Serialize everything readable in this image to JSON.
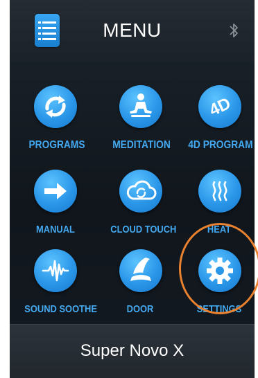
{
  "header": {
    "title": "MENU",
    "menu_icon": "list-menu-icon",
    "bluetooth_icon": "bluetooth-icon"
  },
  "tiles": [
    {
      "label": "PROGRAMS",
      "icon": "refresh-arrows-icon"
    },
    {
      "label": "MEDITATION",
      "icon": "meditation-pose-icon"
    },
    {
      "label": "4D PROGRAM",
      "icon": "4d-icon"
    },
    {
      "label": "MANUAL",
      "icon": "arrow-right-icon"
    },
    {
      "label": "CLOUD TOUCH",
      "icon": "cloud-sync-icon"
    },
    {
      "label": "HEAT",
      "icon": "heat-waves-icon"
    },
    {
      "label": "SOUND SOOTHE",
      "icon": "sound-wave-icon"
    },
    {
      "label": "DOOR",
      "icon": "chair-recline-icon"
    },
    {
      "label": "SETTINGS",
      "icon": "gear-icon"
    }
  ],
  "footer": {
    "device_name": "Super Novo X"
  },
  "colors": {
    "accent": "#2a96e8",
    "label": "#44a9f0",
    "highlight": "#e9812f",
    "background": "#141a21"
  }
}
